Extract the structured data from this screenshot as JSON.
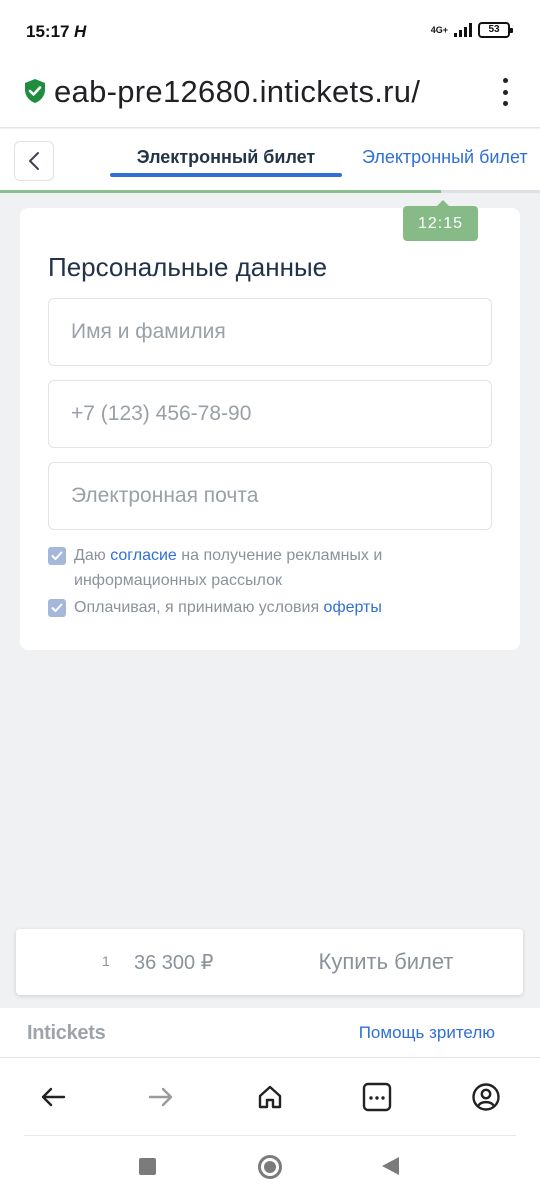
{
  "status_bar": {
    "time": "15:17",
    "app_icon_glyph": "H",
    "network_label": "4G+",
    "battery_level": "53",
    "icons": [
      "signal-icon",
      "battery-icon"
    ]
  },
  "browser": {
    "url": "eab-pre12680.intickets.ru/",
    "secure_icon": "shield-check-icon",
    "menu_icon": "more-vert-icon",
    "nav_icons": [
      "arrow-left-icon",
      "arrow-right-icon",
      "home-icon",
      "tabs-icon",
      "account-icon"
    ],
    "tabs_count_glyph": "..."
  },
  "tabs": {
    "back_icon": "chevron-left-icon",
    "items": [
      {
        "label": "Электронный билет",
        "active": true
      },
      {
        "label": "Электронный билет",
        "active": false
      }
    ],
    "progress_fraction": 0.817,
    "timer": "12:15",
    "accent_color": "#2f6fd6",
    "timer_color": "#86bb87"
  },
  "form": {
    "title": "Персональные данные",
    "name_placeholder": "Имя и фамилия",
    "phone_placeholder": "+7 (123) 456-78-90",
    "email_placeholder": "Электронная почта",
    "consent": {
      "prefix": "Даю ",
      "link": "согласие",
      "suffix": " на получение рекламных и информационных рассылок",
      "checked": true
    },
    "offer": {
      "prefix": "Оплачивая, я принимаю условия ",
      "link": "оферты",
      "checked": true
    }
  },
  "purchase": {
    "quantity": "1",
    "price": "36 300 ₽",
    "buy_label": "Купить билет"
  },
  "footer": {
    "logo": "Intickets",
    "help_link": "Помощь зрителю"
  },
  "system_nav": {
    "icons": [
      "recents-square-icon",
      "home-circle-icon",
      "back-triangle-icon"
    ]
  }
}
